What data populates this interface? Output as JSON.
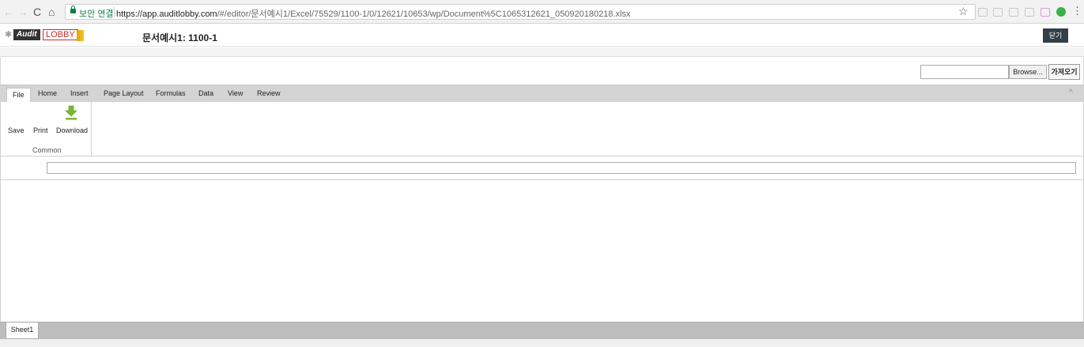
{
  "browser": {
    "nav": {
      "back": "←",
      "forward": "→",
      "reload": "C",
      "home": "⌂"
    },
    "secure_label": "보안 연결",
    "url_host": "https://app.auditlobby.com",
    "url_path": "/#/editor/문서예시1/Excel/75529/1100-1/0/12621/10653/wp/Document%5C1065312621_050920180218.xlsx",
    "star": "☆",
    "kebab": "⋮"
  },
  "header": {
    "logo_mark": "✱",
    "logo_audit": "Audit",
    "logo_lobby": "LOBBY",
    "doc_title": "문서예시1: 1100-1",
    "close_label": "닫기"
  },
  "import": {
    "browse_label": "Browse...",
    "import_label": "가져오기"
  },
  "ribbon": {
    "tabs": [
      {
        "label": "File"
      },
      {
        "label": "Home"
      },
      {
        "label": "Insert"
      },
      {
        "label": "Page Layout"
      },
      {
        "label": "Formulas"
      },
      {
        "label": "Data"
      },
      {
        "label": "View"
      },
      {
        "label": "Review"
      }
    ],
    "active_tab": "File",
    "collapse_icon": "^",
    "buttons": [
      {
        "label": "Save"
      },
      {
        "label": "Print"
      },
      {
        "label": "Download"
      }
    ],
    "group_label": "Common"
  },
  "sheets": [
    {
      "label": "Sheet1"
    }
  ],
  "colors": {
    "close_button": "#333e48",
    "secure_green": "#0b8043",
    "tabbar": "#d4d4d4",
    "sheetbar": "#bdbdbd",
    "download_arrow": "#7cb82f"
  }
}
